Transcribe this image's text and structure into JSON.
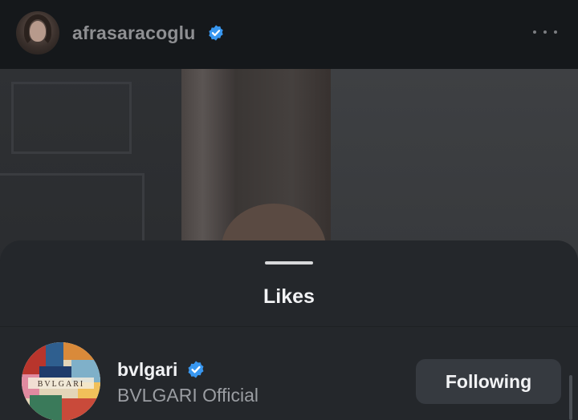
{
  "post": {
    "username": "afrasaracoglu",
    "verified": true,
    "more_icon": "more-horizontal-icon"
  },
  "likes_sheet": {
    "title": "Likes",
    "items": [
      {
        "username": "bvlgari",
        "verified": true,
        "full_name": "BVLGARI Official",
        "action_label": "Following",
        "avatar_logo_text": "BVLGARI"
      }
    ]
  },
  "colors": {
    "verified_badge": "#3897f0",
    "sheet_background": "#24272b",
    "button_background": "#363a40"
  }
}
